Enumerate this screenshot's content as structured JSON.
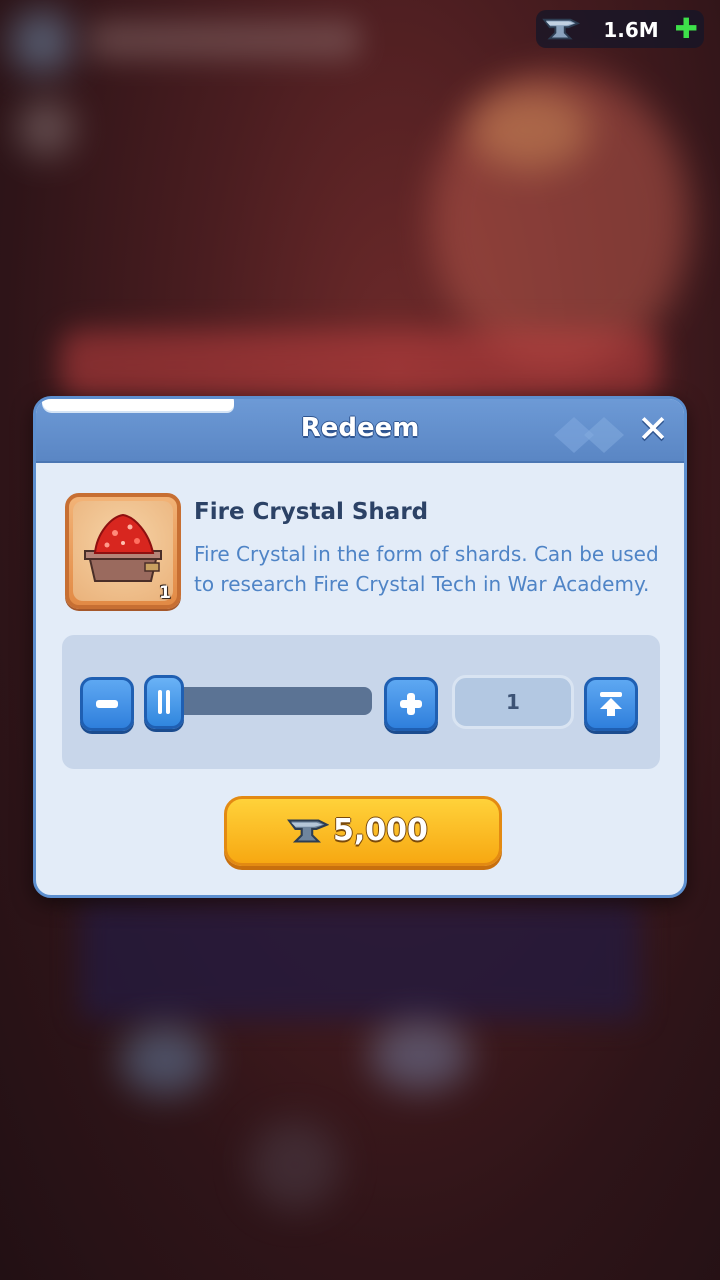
{
  "currency": {
    "icon": "anvil-icon",
    "amount": "1.6M",
    "add_icon": "plus-icon",
    "add_color": "#3ee04a"
  },
  "dialog": {
    "title": "Redeem",
    "close_icon": "close-icon"
  },
  "item": {
    "icon": "fire-crystal-shard-icon",
    "quantity_badge": "1",
    "name": "Fire Crystal Shard",
    "description": "Fire Crystal in the form of shards. Can be used to research Fire Crystal Tech in War Academy."
  },
  "selector": {
    "minus_icon": "minus-icon",
    "plus_icon": "plus-icon",
    "max_icon": "max-arrow-icon",
    "quantity": "1",
    "slider_fraction": 0
  },
  "redeem": {
    "icon": "anvil-icon",
    "cost": "5,000",
    "accent": "#f7a812"
  },
  "colors": {
    "header": "#5a86c4",
    "panel": "#e3ecf8",
    "accent_blue": "#2f7fdc"
  }
}
